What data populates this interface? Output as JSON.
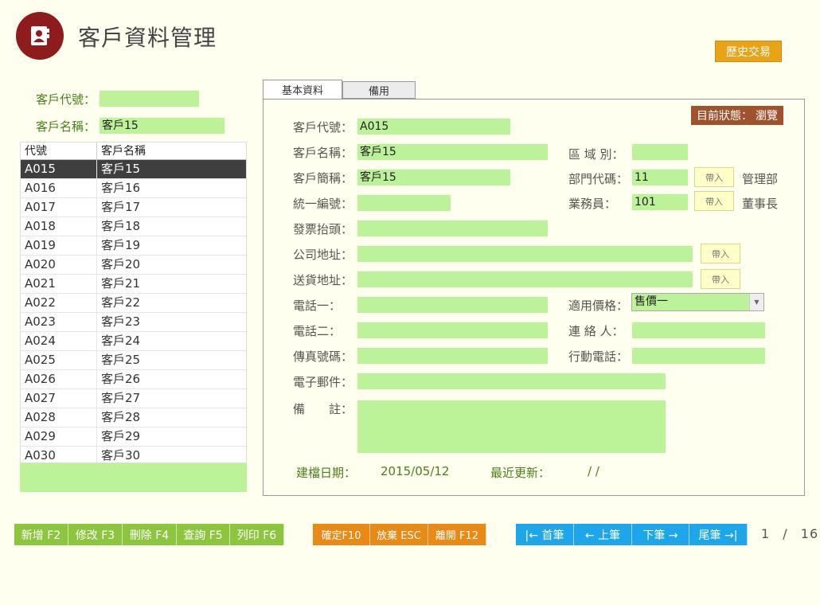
{
  "app": {
    "title": "客戶資料管理",
    "logo_icon": "address-book-icon",
    "brand_color": "#8e1c1c"
  },
  "header": {
    "history_button": "歷史交易"
  },
  "search": {
    "code_label": "客戶代號：",
    "code_value": "",
    "name_label": "客戶名稱：",
    "name_value": "客戶15"
  },
  "list": {
    "columns": [
      "代號",
      "客戶名稱"
    ],
    "rows": [
      {
        "code": "A015",
        "name": "客戶15",
        "selected": true
      },
      {
        "code": "A016",
        "name": "客戶16"
      },
      {
        "code": "A017",
        "name": "客戶17"
      },
      {
        "code": "A018",
        "name": "客戶18"
      },
      {
        "code": "A019",
        "name": "客戶19"
      },
      {
        "code": "A020",
        "name": "客戶20"
      },
      {
        "code": "A021",
        "name": "客戶21"
      },
      {
        "code": "A022",
        "name": "客戶22"
      },
      {
        "code": "A023",
        "name": "客戶23"
      },
      {
        "code": "A024",
        "name": "客戶24"
      },
      {
        "code": "A025",
        "name": "客戶25"
      },
      {
        "code": "A026",
        "name": "客戶26"
      },
      {
        "code": "A027",
        "name": "客戶27"
      },
      {
        "code": "A028",
        "name": "客戶28"
      },
      {
        "code": "A029",
        "name": "客戶29"
      },
      {
        "code": "A030",
        "name": "客戶30"
      }
    ]
  },
  "tabs": [
    "基本資料",
    "備用"
  ],
  "status": {
    "label": "目前狀態：",
    "value": "瀏覽"
  },
  "form": {
    "code": {
      "label": "客戶代號：",
      "value": "A015"
    },
    "name": {
      "label": "客戶名稱：",
      "value": "客戶15"
    },
    "region": {
      "label": "區 域 別：",
      "value": ""
    },
    "short_name": {
      "label": "客戶簡稱：",
      "value": "客戶15"
    },
    "dept_code": {
      "label": "部門代碼：",
      "value": "11",
      "import": "帶入",
      "dept_name": "管理部"
    },
    "tax_id": {
      "label": "統一編號：",
      "value": ""
    },
    "salesperson": {
      "label": "業務員：",
      "value": "101",
      "import": "帶入",
      "person_title": "董事長"
    },
    "invoice_title": {
      "label": "發票抬頭：",
      "value": ""
    },
    "company_address": {
      "label": "公司地址：",
      "value": "",
      "import": "帶入"
    },
    "delivery_address": {
      "label": "送貨地址：",
      "value": "",
      "import": "帶入"
    },
    "phone1": {
      "label": "電話一：",
      "value": ""
    },
    "price_type": {
      "label": "適用價格：",
      "value": "售價一"
    },
    "phone2": {
      "label": "電話二：",
      "value": ""
    },
    "contact": {
      "label": "連 絡 人：",
      "value": ""
    },
    "fax": {
      "label": "傳真號碼：",
      "value": ""
    },
    "mobile": {
      "label": "行動電話：",
      "value": ""
    },
    "email": {
      "label": "電子郵件：",
      "value": ""
    },
    "remarks": {
      "label": "備　　註：",
      "value": ""
    },
    "created": {
      "label": "建檔日期：",
      "value": "2015/05/12"
    },
    "updated": {
      "label": "最近更新：",
      "value": "/ /"
    }
  },
  "actions": {
    "crud": [
      "新增 F2",
      "修改 F3",
      "刪除 F4",
      "查詢 F5",
      "列印 F6"
    ],
    "confirm": [
      "確定F10",
      "放棄 ESC",
      "離開 F12"
    ],
    "nav": [
      "|← 首筆",
      "← 上筆",
      "下筆 →",
      "尾筆 →|"
    ]
  },
  "pager": {
    "current": "1",
    "separator": "/",
    "total": "16"
  },
  "colors": {
    "field_green": "#bdf398",
    "crud_green": "#8cc63f",
    "confirm_orange": "#ea8a16",
    "nav_blue": "#1da6e9",
    "status_brown": "#a0522d"
  }
}
